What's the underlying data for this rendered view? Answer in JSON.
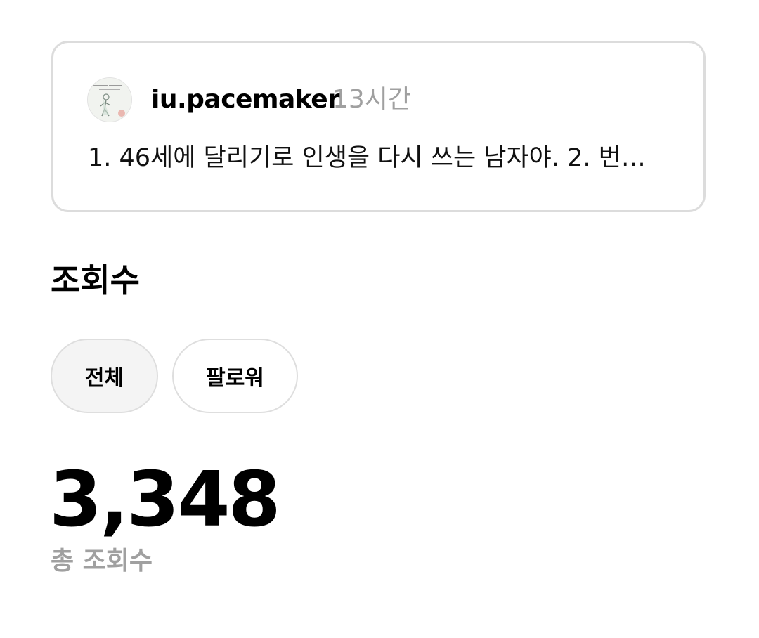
{
  "post": {
    "username": "iu.pacemaker",
    "time_ago": "13시간",
    "text": "1. 46세에 달리기로 인생을 다시 쓰는 남자야. 2. 번…"
  },
  "views": {
    "title": "조회수",
    "filters": {
      "all": "전체",
      "followers": "팔로워"
    },
    "selected_filter": "전체",
    "total_value": "3,348",
    "total_label": "총 조회수"
  },
  "colors": {
    "card_border": "#dcdcdc",
    "muted_text": "#a0a0a0",
    "selected_chip_bg": "#f4f4f4"
  },
  "icons": {
    "avatar": "book-cover-avatar"
  }
}
